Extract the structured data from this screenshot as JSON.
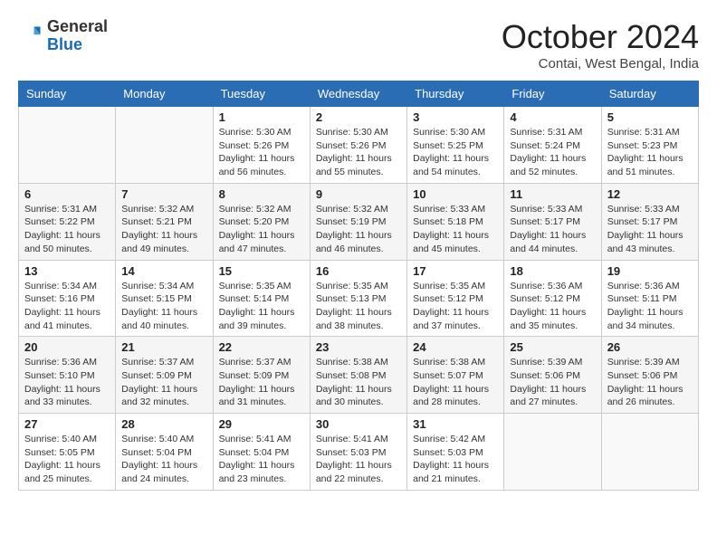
{
  "header": {
    "logo_general": "General",
    "logo_blue": "Blue",
    "month_title": "October 2024",
    "location": "Contai, West Bengal, India"
  },
  "weekdays": [
    "Sunday",
    "Monday",
    "Tuesday",
    "Wednesday",
    "Thursday",
    "Friday",
    "Saturday"
  ],
  "weeks": [
    [
      {
        "day": "",
        "text": ""
      },
      {
        "day": "",
        "text": ""
      },
      {
        "day": "1",
        "text": "Sunrise: 5:30 AM\nSunset: 5:26 PM\nDaylight: 11 hours and 56 minutes."
      },
      {
        "day": "2",
        "text": "Sunrise: 5:30 AM\nSunset: 5:26 PM\nDaylight: 11 hours and 55 minutes."
      },
      {
        "day": "3",
        "text": "Sunrise: 5:30 AM\nSunset: 5:25 PM\nDaylight: 11 hours and 54 minutes."
      },
      {
        "day": "4",
        "text": "Sunrise: 5:31 AM\nSunset: 5:24 PM\nDaylight: 11 hours and 52 minutes."
      },
      {
        "day": "5",
        "text": "Sunrise: 5:31 AM\nSunset: 5:23 PM\nDaylight: 11 hours and 51 minutes."
      }
    ],
    [
      {
        "day": "6",
        "text": "Sunrise: 5:31 AM\nSunset: 5:22 PM\nDaylight: 11 hours and 50 minutes."
      },
      {
        "day": "7",
        "text": "Sunrise: 5:32 AM\nSunset: 5:21 PM\nDaylight: 11 hours and 49 minutes."
      },
      {
        "day": "8",
        "text": "Sunrise: 5:32 AM\nSunset: 5:20 PM\nDaylight: 11 hours and 47 minutes."
      },
      {
        "day": "9",
        "text": "Sunrise: 5:32 AM\nSunset: 5:19 PM\nDaylight: 11 hours and 46 minutes."
      },
      {
        "day": "10",
        "text": "Sunrise: 5:33 AM\nSunset: 5:18 PM\nDaylight: 11 hours and 45 minutes."
      },
      {
        "day": "11",
        "text": "Sunrise: 5:33 AM\nSunset: 5:17 PM\nDaylight: 11 hours and 44 minutes."
      },
      {
        "day": "12",
        "text": "Sunrise: 5:33 AM\nSunset: 5:17 PM\nDaylight: 11 hours and 43 minutes."
      }
    ],
    [
      {
        "day": "13",
        "text": "Sunrise: 5:34 AM\nSunset: 5:16 PM\nDaylight: 11 hours and 41 minutes."
      },
      {
        "day": "14",
        "text": "Sunrise: 5:34 AM\nSunset: 5:15 PM\nDaylight: 11 hours and 40 minutes."
      },
      {
        "day": "15",
        "text": "Sunrise: 5:35 AM\nSunset: 5:14 PM\nDaylight: 11 hours and 39 minutes."
      },
      {
        "day": "16",
        "text": "Sunrise: 5:35 AM\nSunset: 5:13 PM\nDaylight: 11 hours and 38 minutes."
      },
      {
        "day": "17",
        "text": "Sunrise: 5:35 AM\nSunset: 5:12 PM\nDaylight: 11 hours and 37 minutes."
      },
      {
        "day": "18",
        "text": "Sunrise: 5:36 AM\nSunset: 5:12 PM\nDaylight: 11 hours and 35 minutes."
      },
      {
        "day": "19",
        "text": "Sunrise: 5:36 AM\nSunset: 5:11 PM\nDaylight: 11 hours and 34 minutes."
      }
    ],
    [
      {
        "day": "20",
        "text": "Sunrise: 5:36 AM\nSunset: 5:10 PM\nDaylight: 11 hours and 33 minutes."
      },
      {
        "day": "21",
        "text": "Sunrise: 5:37 AM\nSunset: 5:09 PM\nDaylight: 11 hours and 32 minutes."
      },
      {
        "day": "22",
        "text": "Sunrise: 5:37 AM\nSunset: 5:09 PM\nDaylight: 11 hours and 31 minutes."
      },
      {
        "day": "23",
        "text": "Sunrise: 5:38 AM\nSunset: 5:08 PM\nDaylight: 11 hours and 30 minutes."
      },
      {
        "day": "24",
        "text": "Sunrise: 5:38 AM\nSunset: 5:07 PM\nDaylight: 11 hours and 28 minutes."
      },
      {
        "day": "25",
        "text": "Sunrise: 5:39 AM\nSunset: 5:06 PM\nDaylight: 11 hours and 27 minutes."
      },
      {
        "day": "26",
        "text": "Sunrise: 5:39 AM\nSunset: 5:06 PM\nDaylight: 11 hours and 26 minutes."
      }
    ],
    [
      {
        "day": "27",
        "text": "Sunrise: 5:40 AM\nSunset: 5:05 PM\nDaylight: 11 hours and 25 minutes."
      },
      {
        "day": "28",
        "text": "Sunrise: 5:40 AM\nSunset: 5:04 PM\nDaylight: 11 hours and 24 minutes."
      },
      {
        "day": "29",
        "text": "Sunrise: 5:41 AM\nSunset: 5:04 PM\nDaylight: 11 hours and 23 minutes."
      },
      {
        "day": "30",
        "text": "Sunrise: 5:41 AM\nSunset: 5:03 PM\nDaylight: 11 hours and 22 minutes."
      },
      {
        "day": "31",
        "text": "Sunrise: 5:42 AM\nSunset: 5:03 PM\nDaylight: 11 hours and 21 minutes."
      },
      {
        "day": "",
        "text": ""
      },
      {
        "day": "",
        "text": ""
      }
    ]
  ]
}
